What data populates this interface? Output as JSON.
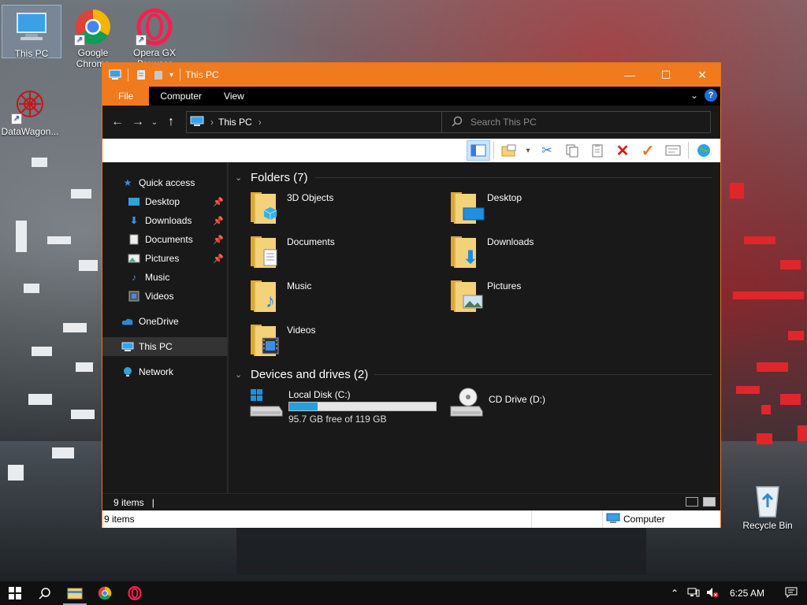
{
  "desktop": {
    "icons": [
      {
        "label": "This PC"
      },
      {
        "label": "Google Chrome"
      },
      {
        "label": "Opera GX Browser"
      },
      {
        "label": "DataWagon..."
      },
      {
        "label": "Recycle Bin"
      }
    ]
  },
  "window": {
    "title": "This PC",
    "ribbon_tabs": [
      "File",
      "Computer",
      "View"
    ],
    "help_label": "?",
    "address": {
      "crumb": "This PC"
    },
    "search": {
      "placeholder": "Search This PC"
    },
    "nav": {
      "quick_access": "Quick access",
      "items": [
        "Desktop",
        "Downloads",
        "Documents",
        "Pictures",
        "Music",
        "Videos"
      ],
      "onedrive": "OneDrive",
      "this_pc": "This PC",
      "network": "Network"
    },
    "folders_header": "Folders (7)",
    "folders": [
      "3D Objects",
      "Desktop",
      "Documents",
      "Downloads",
      "Music",
      "Pictures",
      "Videos"
    ],
    "drives_header": "Devices and drives (2)",
    "drives": [
      {
        "name": "Local Disk (C:)",
        "free_text": "95.7 GB free of 119 GB",
        "used_fraction": 0.196
      },
      {
        "name": "CD Drive (D:)"
      }
    ],
    "status_items": "9 items",
    "status_items_2": "9 items",
    "status_location": "Computer"
  },
  "taskbar": {
    "time": "6:25 AM"
  },
  "colors": {
    "accent": "#f07b1e",
    "folder": "#f4d27a",
    "drive_fill": "#26a0da"
  }
}
